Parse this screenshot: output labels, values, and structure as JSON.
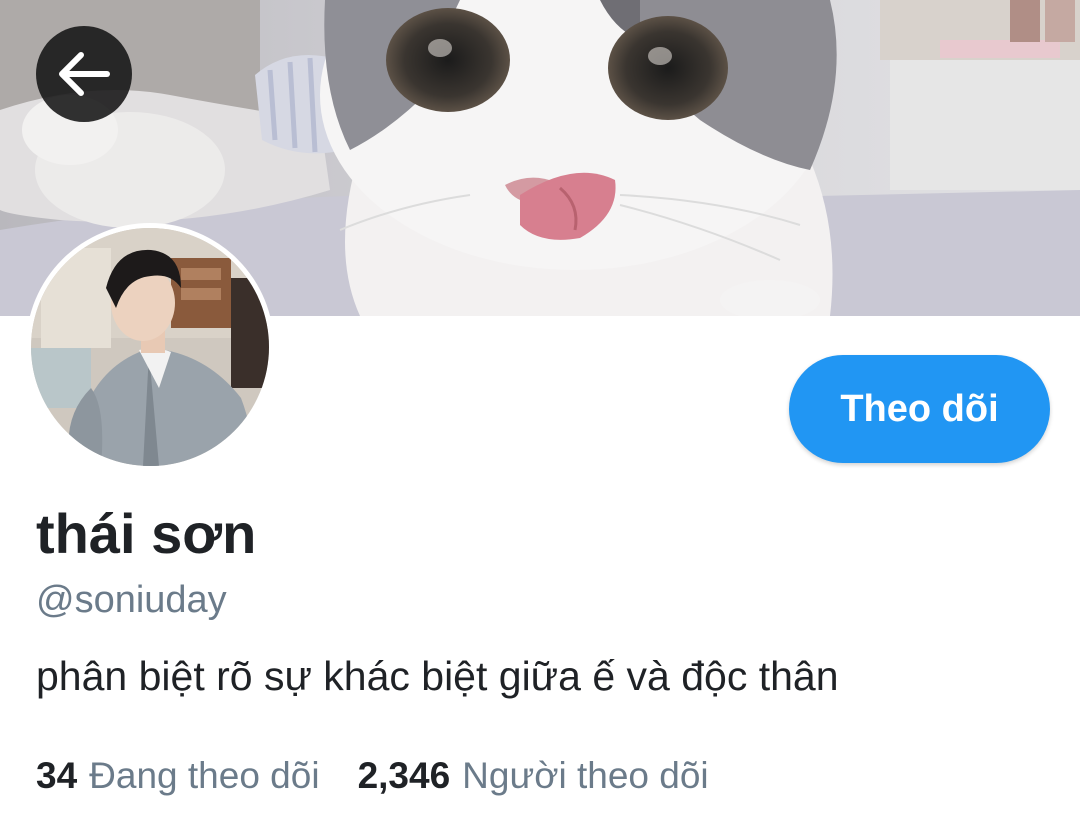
{
  "header": {
    "back_icon": "arrow-left-icon"
  },
  "banner": {
    "description_icon": "banner-image"
  },
  "profile": {
    "display_name": "thái sơn",
    "handle": "@soniuday",
    "bio": "phân biệt rõ sự khác biệt giữa ế và độc thân",
    "follow_label": "Theo dõi"
  },
  "stats": {
    "following_count": "34",
    "following_label": "Đang theo dõi",
    "followers_count": "2,346",
    "followers_label": "Người theo dõi"
  },
  "colors": {
    "accent": "#2196f3",
    "text_primary": "#1f2226",
    "text_secondary": "#6b7b8a"
  }
}
